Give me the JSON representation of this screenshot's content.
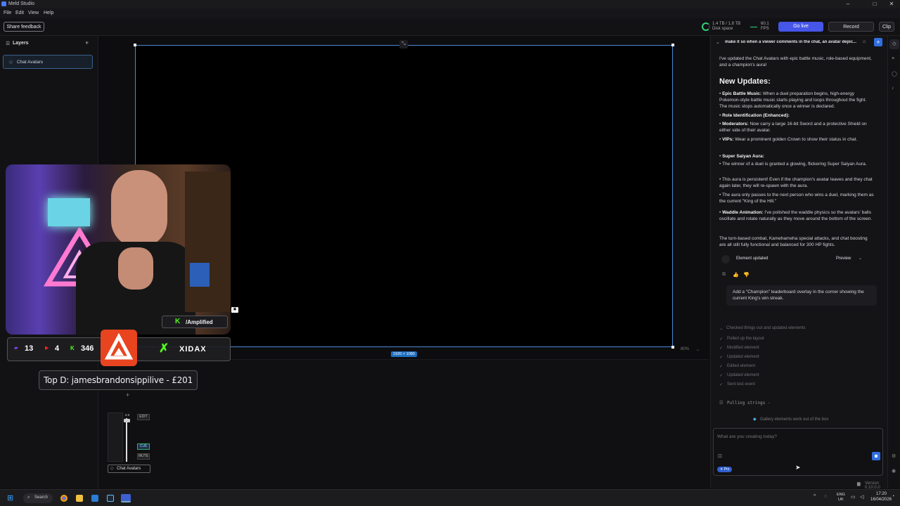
{
  "window": {
    "title": "Meld Studio"
  },
  "menu": [
    "File",
    "Edit",
    "View",
    "Help"
  ],
  "toolbar": {
    "feedback": "Share feedback",
    "disk_value": "1.4 TB / 1.8 TB",
    "disk_label": "Disk space",
    "fps_value": "60.1",
    "fps_label": "FPS",
    "go_live": "Go live",
    "record": "Record",
    "clip": "Clip"
  },
  "layers": {
    "title": "Layers",
    "items": [
      "Chat Avatars"
    ]
  },
  "canvas": {
    "resolution": "1920 × 1080",
    "zoom": "80%"
  },
  "mixer": {
    "edit": "EDIT",
    "cue": "CUE",
    "mute": "MUTE",
    "source": "Chat Avatars",
    "level": "0.0"
  },
  "webcam_overlay": {
    "handle": "/Amplified",
    "twitch_count": "13",
    "youtube_count": "4",
    "kick_count": "346",
    "sponsor": "XIDAX",
    "top_donor": "Top D: jamesbrandonsippilive - £201"
  },
  "chat": {
    "thread_title": "make it so when a viewer comments in the chat, an avatar depic...",
    "intro": "I've updated the Chat Avatars with epic battle music, role-based equipment, and a champion's aura!",
    "heading": "New Updates:",
    "bullets": [
      {
        "bold": "Epic Battle Music:",
        "text": " When a duel preparation begins, high-energy Pokemon-style battle music starts playing and loops throughout the fight. The music stops automatically once a winner is declared."
      },
      {
        "bold": "Role Identification (Enhanced):",
        "text": ""
      },
      {
        "bold": "Moderators:",
        "text": " Now carry a large 16-bit Sword and a protective Shield on either side of their avatar."
      },
      {
        "bold": "VIPs:",
        "text": " Wear a prominent golden Crown to show their status in chat."
      },
      {
        "bold": "Super Saiyan Aura:",
        "text": ""
      },
      {
        "bold": "",
        "text": "The winner of a duel is granted a glowing, flickering Super Saiyan Aura."
      },
      {
        "bold": "",
        "text": "This aura is persistent! Even if the champion's avatar leaves and they chat again later, they will re-spawn with the aura."
      },
      {
        "bold": "",
        "text": "The aura only passes to the next person who wins a duel, marking them as the current \"King of the Hill.\""
      },
      {
        "bold": "Waddle Animation:",
        "text": " I've polished the waddle physics so the avatars' balls oscillate and rotate naturally as they move around the bottom of the screen."
      }
    ],
    "outro": "The turn-based combat, Kamehameha special attacks, and chat boosting are all still fully functional and balanced for 300 HP fights.",
    "element_updated": "Element updated",
    "preview": "Preview",
    "user_message": "Add a \"Champion\" leaderboard overlay in the corner showing the current King's win streak.",
    "checked": "Checked things out and updated elements",
    "steps": [
      "Pulled up the layout",
      "Modified element",
      "Updated element",
      "Edited element",
      "Updated element",
      "Sent test event"
    ],
    "pulling": "Pulling strings -",
    "tip": "Gallery elements work out of the box",
    "input_placeholder": "What are you creating today?",
    "pro": "Pro"
  },
  "footer": {
    "version": "Version 0.10.0.0"
  },
  "taskbar": {
    "search": "Search",
    "lang1": "ENG",
    "lang2": "UK",
    "time": "17:20",
    "date": "16/04/2026"
  }
}
